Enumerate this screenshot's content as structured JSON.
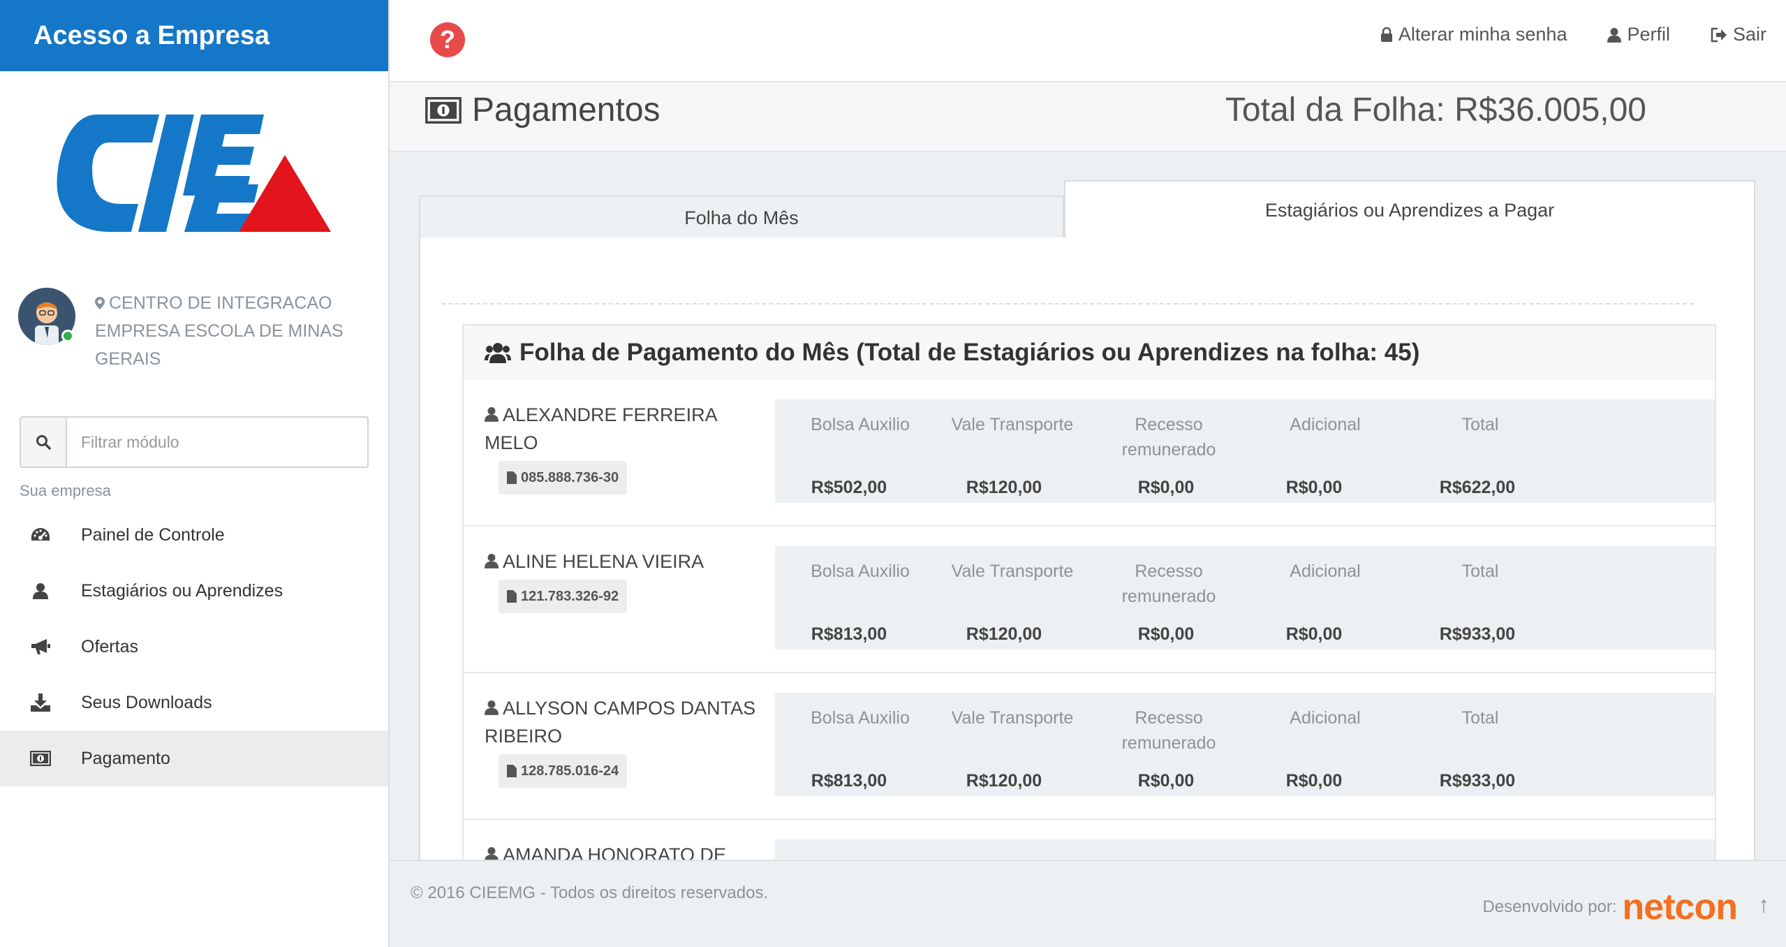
{
  "sidebar": {
    "brand": "Acesso a Empresa",
    "company_name": "CENTRO DE INTEGRACAO EMPRESA ESCOLA DE MINAS GERAIS",
    "search_placeholder": "Filtrar módulo",
    "section_label": "Sua empresa",
    "menu": [
      {
        "label": "Painel de Controle",
        "icon": "dashboard-icon",
        "active": false
      },
      {
        "label": "Estagiários ou Aprendizes",
        "icon": "user-icon",
        "active": false
      },
      {
        "label": "Ofertas",
        "icon": "bullhorn-icon",
        "active": false
      },
      {
        "label": "Seus Downloads",
        "icon": "download-icon",
        "active": false
      },
      {
        "label": "Pagamento",
        "icon": "money-icon",
        "active": true
      }
    ]
  },
  "topbar": {
    "help_icon": "?",
    "change_password": "Alterar minha senha",
    "profile": "Perfil",
    "logout": "Sair"
  },
  "page": {
    "title": "Pagamentos",
    "total_folha": "Total da Folha: R$36.005,00"
  },
  "tabs": [
    {
      "label": "Folha do Mês",
      "active": false
    },
    {
      "label": "Estagiários ou Aprendizes a Pagar",
      "active": true
    }
  ],
  "payroll": {
    "header": "Folha de Pagamento do Mês (Total de Estagiários ou Aprendizes na folha: 45)",
    "columns": [
      "Bolsa Auxilio",
      "Vale Transporte",
      "Recesso remunerado",
      "Adicional",
      "Total"
    ],
    "rows": [
      {
        "name": "ALEXANDRE FERREIRA MELO",
        "cpf": "085.888.736-30",
        "values": [
          "R$502,00",
          "R$120,00",
          "R$0,00",
          "R$0,00",
          "R$622,00"
        ]
      },
      {
        "name": "ALINE HELENA VIEIRA",
        "cpf": "121.783.326-92",
        "values": [
          "R$813,00",
          "R$120,00",
          "R$0,00",
          "R$0,00",
          "R$933,00"
        ]
      },
      {
        "name": "ALLYSON CAMPOS DANTAS RIBEIRO",
        "cpf": "128.785.016-24",
        "values": [
          "R$813,00",
          "R$120,00",
          "R$0,00",
          "R$0,00",
          "R$933,00"
        ]
      },
      {
        "name": "AMANDA HONORATO DE"
      }
    ]
  },
  "footer": {
    "copyright": "© 2016 CIEEMG - Todos os direitos reservados.",
    "developed_by": "Desenvolvido por:",
    "developer_logo": "netcon",
    "scroll_top": "↑"
  },
  "colors": {
    "brand_blue": "#1577c8",
    "logo_red": "#e3141b",
    "help_red": "#e84a4a",
    "netcon_orange": "#f37021"
  }
}
